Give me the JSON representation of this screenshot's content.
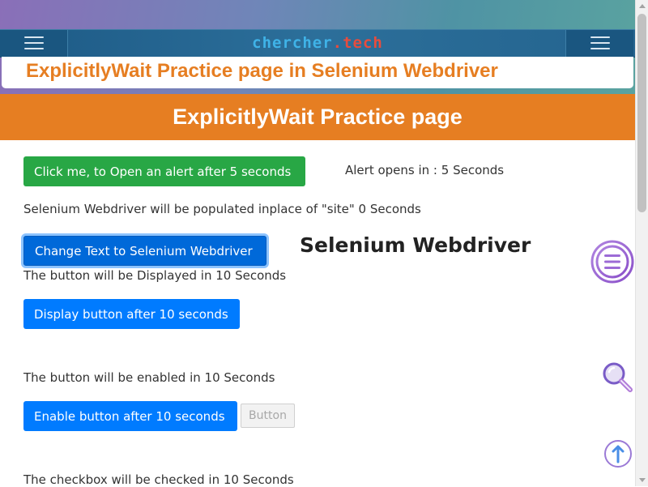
{
  "header": {
    "logo_part1": "chercher",
    "logo_dot": ".",
    "logo_part2": "tech",
    "page_heading": "ExplicitlyWait Practice page in Selenium Webdriver"
  },
  "banner": {
    "title": "ExplicitlyWait Practice page"
  },
  "content": {
    "alert_button": "Click me, to Open an alert after 5 seconds",
    "alert_info": "Alert opens in : 5 Seconds",
    "populate_info": "Selenium Webdriver will be populated inplace of \"site\" 0 Seconds",
    "change_text_button": "Change Text to Selenium Webdriver",
    "changed_text": "Selenium Webdriver",
    "display_info": "The button will be Displayed in 10 Seconds",
    "display_button": "Display button after 10 seconds",
    "enable_info": "The button will be enabled in 10 Seconds",
    "enable_button": "Enable button after 10 seconds",
    "disabled_button": "Button",
    "checkbox_info": "The checkbox will be checked in 10 Seconds"
  },
  "floating_icons": [
    "list-menu-icon",
    "search-icon",
    "scroll-up-arrow-icon"
  ],
  "colors": {
    "accent_orange": "#e67e22",
    "green_button": "#28a745",
    "blue_button": "#007bff",
    "topbar": "#24648f",
    "logo_blue": "#3fb3e8",
    "logo_red": "#e84c3d"
  }
}
